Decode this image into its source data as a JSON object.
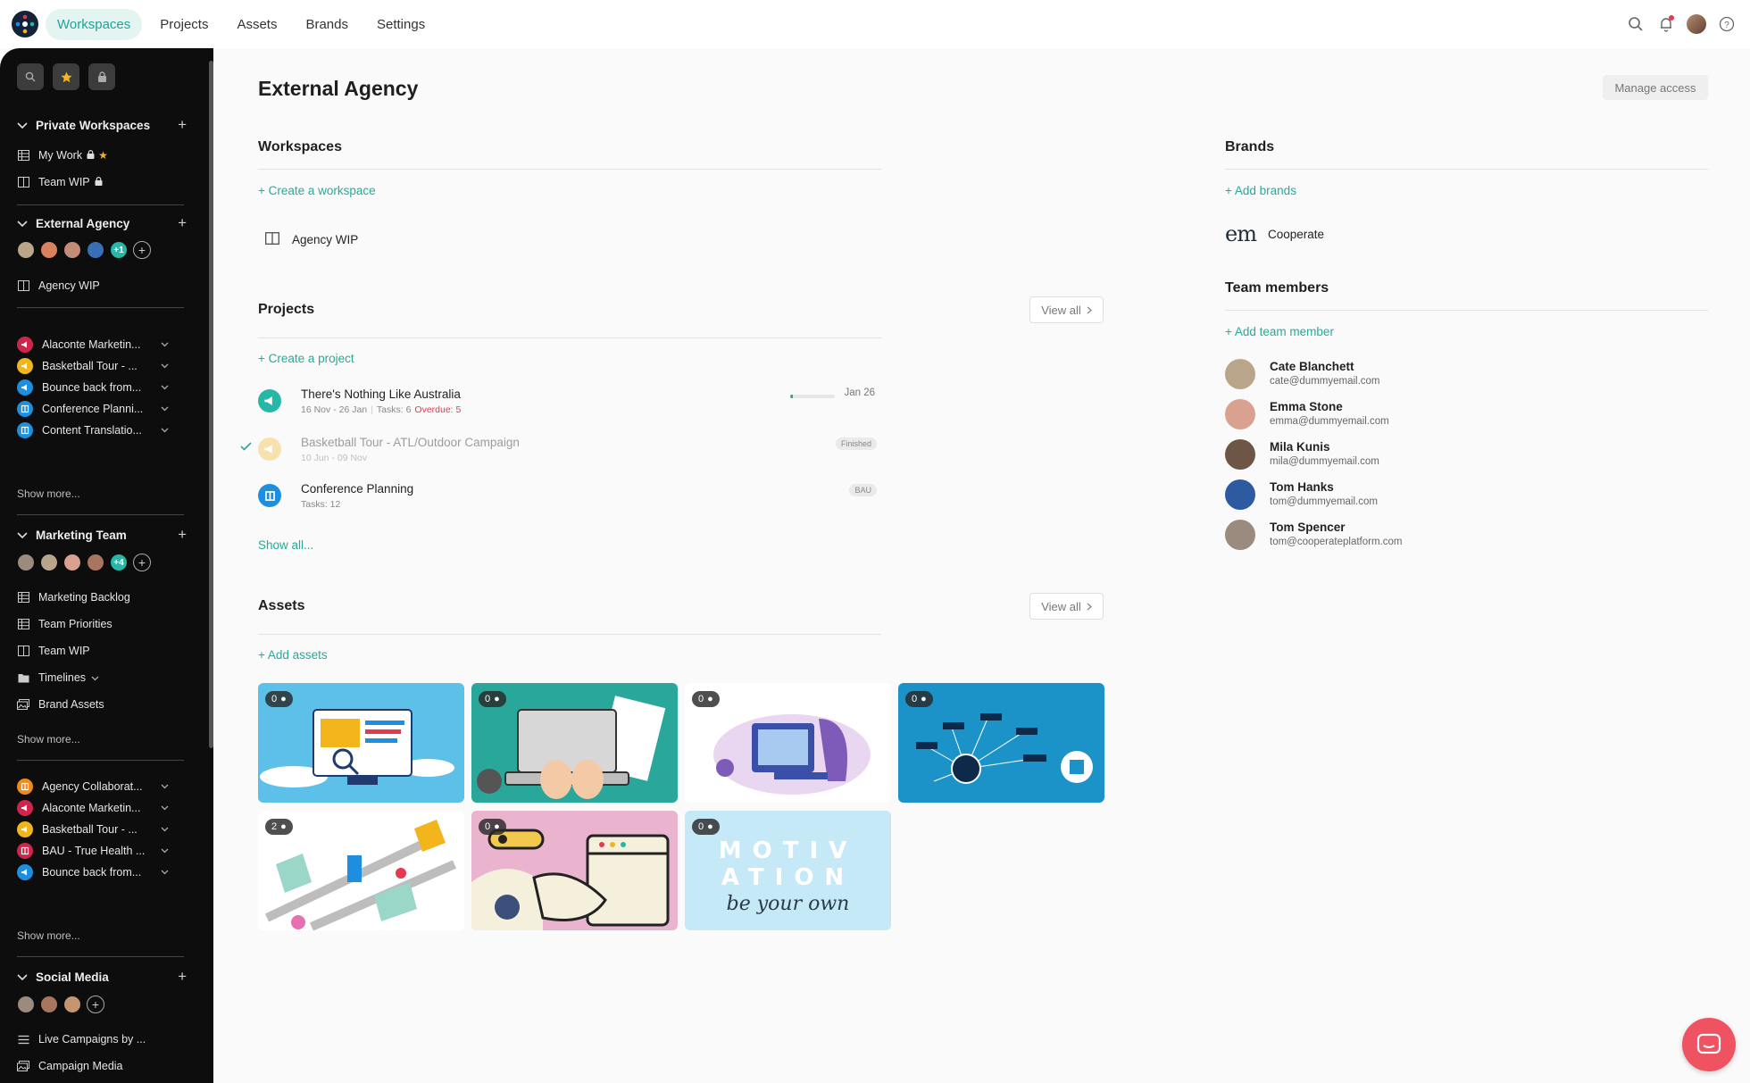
{
  "topnav": {
    "items": [
      "Workspaces",
      "Projects",
      "Assets",
      "Brands",
      "Settings"
    ],
    "active": "Workspaces"
  },
  "sidebar": {
    "private_workspaces": {
      "title": "Private Workspaces",
      "items": [
        {
          "label": "My Work",
          "icon": "table-icon"
        },
        {
          "label": "Team WIP",
          "icon": "board-icon"
        }
      ]
    },
    "external_agency": {
      "title": "External Agency",
      "avatar_extra": "+1",
      "workspaces": [
        {
          "label": "Agency WIP",
          "icon": "board-icon"
        }
      ],
      "projects": [
        {
          "label": "Alaconte Marketin...",
          "color": "#d0254a",
          "icon": "megaphone-icon"
        },
        {
          "label": "Basketball Tour - ...",
          "color": "#f2b51c",
          "icon": "megaphone-icon"
        },
        {
          "label": "Bounce back from...",
          "color": "#1e8fe0",
          "icon": "megaphone-icon"
        },
        {
          "label": "Conference Planni...",
          "color": "#1e8fe0",
          "icon": "board-icon"
        },
        {
          "label": "Content Translatio...",
          "color": "#1e8fe0",
          "icon": "board-icon"
        }
      ],
      "show_more": "Show more..."
    },
    "marketing_team": {
      "title": "Marketing Team",
      "avatar_extra": "+4",
      "workspaces": [
        {
          "label": "Marketing Backlog",
          "icon": "table-icon"
        },
        {
          "label": "Team Priorities",
          "icon": "table-icon"
        },
        {
          "label": "Team WIP",
          "icon": "board-icon"
        },
        {
          "label": "Timelines",
          "icon": "folder-icon"
        },
        {
          "label": "Brand Assets",
          "icon": "images-icon"
        }
      ],
      "show_more": "Show more...",
      "projects": [
        {
          "label": "Agency Collaborat...",
          "color": "#f08a1c",
          "icon": "board-icon"
        },
        {
          "label": "Alaconte Marketin...",
          "color": "#d0254a",
          "icon": "megaphone-icon"
        },
        {
          "label": "Basketball Tour - ...",
          "color": "#f2b51c",
          "icon": "megaphone-icon"
        },
        {
          "label": "BAU - True Health ...",
          "color": "#d0254a",
          "icon": "board-icon"
        },
        {
          "label": "Bounce back from...",
          "color": "#1e8fe0",
          "icon": "megaphone-icon"
        }
      ],
      "show_more_projects": "Show more..."
    },
    "social_media": {
      "title": "Social Media",
      "workspaces": [
        {
          "label": "Live Campaigns by ...",
          "icon": "list-icon"
        },
        {
          "label": "Campaign Media",
          "icon": "images-icon"
        }
      ]
    }
  },
  "main": {
    "title": "External Agency",
    "manage_access": "Manage access",
    "workspaces": {
      "title": "Workspaces",
      "create": "+ Create a workspace",
      "items": [
        {
          "label": "Agency WIP",
          "icon": "board-icon"
        }
      ]
    },
    "projects": {
      "title": "Projects",
      "view_all": "View all",
      "create": "+ Create a project",
      "show_all": "Show all...",
      "items": [
        {
          "name": "There's Nothing Like Australia",
          "start": "16 Nov",
          "end": "26 Jan",
          "tasks": "Tasks: 6",
          "overdue": "Overdue: 5",
          "due": "Jan 26",
          "progress": 0.05,
          "color": "#26b7a7",
          "icon": "megaphone-icon"
        },
        {
          "name": "Basketball Tour - ATL/Outdoor Campaign",
          "start": "10 Jun",
          "end": "09 Nov",
          "badge": "Finished",
          "color": "#f7d98a",
          "icon": "megaphone-icon",
          "finished": true
        },
        {
          "name": "Conference Planning",
          "tasks": "Tasks: 12",
          "badge": "BAU",
          "color": "#1e8fe0",
          "icon": "board-icon"
        }
      ]
    },
    "assets": {
      "title": "Assets",
      "view_all": "View all",
      "add": "+ Add assets",
      "items": [
        {
          "comments": "0",
          "bg": "#5cc0e8"
        },
        {
          "comments": "0",
          "bg": "#2aa79b"
        },
        {
          "comments": "0",
          "bg": "#ffffff"
        },
        {
          "comments": "0",
          "bg": "#1b93c9"
        },
        {
          "comments": "2",
          "bg": "#ffffff"
        },
        {
          "comments": "0",
          "bg": "#eab4cf"
        },
        {
          "comments": "0",
          "bg": "#c5e9f7",
          "text_line1": "MOTIV",
          "text_line2": "ATION",
          "text_line3": "be your own"
        }
      ]
    },
    "brands": {
      "title": "Brands",
      "add": "+ Add brands",
      "items": [
        {
          "logo": "em",
          "name": "Cooperate"
        }
      ]
    },
    "team": {
      "title": "Team members",
      "add": "+ Add team member",
      "members": [
        {
          "name": "Cate Blanchett",
          "email": "cate@dummyemail.com",
          "color": "#b9a58a"
        },
        {
          "name": "Emma Stone",
          "email": "emma@dummyemail.com",
          "color": "#d9a18f"
        },
        {
          "name": "Mila Kunis",
          "email": "mila@dummyemail.com",
          "color": "#6e5646"
        },
        {
          "name": "Tom Hanks",
          "email": "tom@dummyemail.com",
          "color": "#2d5aa0"
        },
        {
          "name": "Tom Spencer",
          "email": "tom@cooperateplatform.com",
          "color": "#9b8a7e"
        }
      ]
    }
  },
  "colors": {
    "accent": "#27aa99",
    "overdue": "#e53950",
    "sidebar_bg": "#0d0d0d"
  }
}
